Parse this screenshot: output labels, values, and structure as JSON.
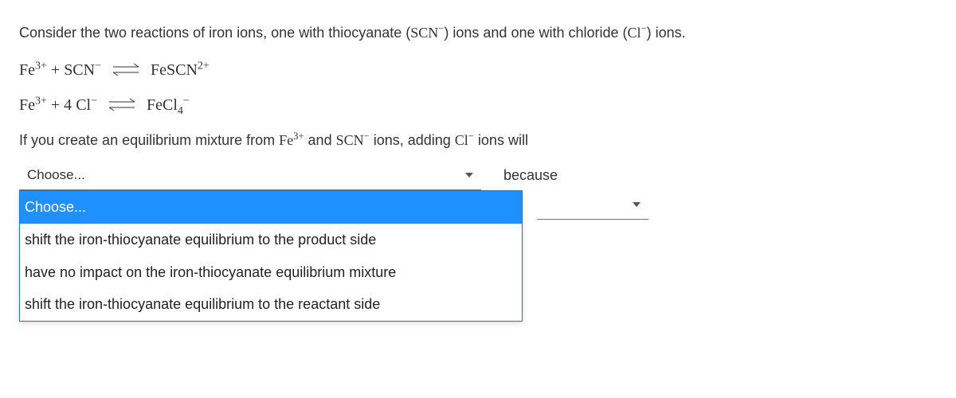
{
  "intro": {
    "part1": "Consider the two reactions of iron ions, one with thiocyanate (",
    "scn": "SCN",
    "part2": ") ions and one with chloride (",
    "cl": "Cl",
    "part3": ") ions."
  },
  "eq1": {
    "lhs1": "Fe",
    "lhs1_sup": "3+",
    "plus1": " + ",
    "lhs2": "SCN",
    "lhs2_sup": "−",
    "rhs": "FeSCN",
    "rhs_sup": "2+"
  },
  "eq2": {
    "lhs1": "Fe",
    "lhs1_sup": "3+",
    "plus1": " + 4 ",
    "lhs2": "Cl",
    "lhs2_sup": "−",
    "rhs": "FeCl",
    "rhs_sub": "4",
    "rhs_sup": "−"
  },
  "prompt": {
    "p1": "If you create an equilibrium mixture from ",
    "fe": "Fe",
    "fe_sup": "3+",
    "p2": " and ",
    "scn": "SCN",
    "scn_sup": "−",
    "p3": " ions, adding ",
    "cl": "Cl",
    "cl_sup": "−",
    "p4": " ions will"
  },
  "select1": {
    "value": "Choose...",
    "options": [
      "Choose...",
      "shift the iron-thiocyanate equilibrium to the product side",
      "have no impact on the iron-thiocyanate equilibrium mixture",
      "shift the iron-thiocyanate equilibrium to the reactant side"
    ]
  },
  "between_text": "because",
  "select2": {
    "value": ""
  }
}
